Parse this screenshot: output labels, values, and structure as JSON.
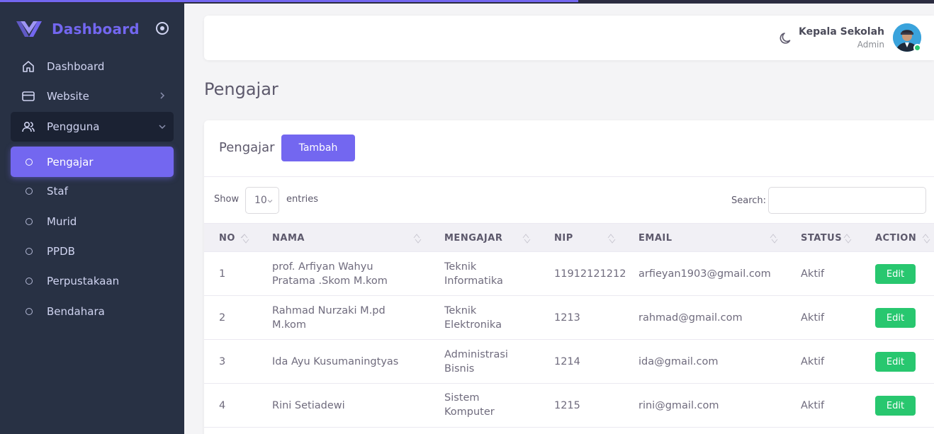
{
  "sidebar": {
    "brand": "Dashboard",
    "items": [
      {
        "label": "Dashboard",
        "icon": "home-icon"
      },
      {
        "label": "Website",
        "icon": "credit-card-icon"
      },
      {
        "label": "Pengguna",
        "icon": "users-icon"
      }
    ],
    "subitems": [
      {
        "label": "Pengajar"
      },
      {
        "label": "Staf"
      },
      {
        "label": "Murid"
      },
      {
        "label": "PPDB"
      },
      {
        "label": "Perpustakaan"
      },
      {
        "label": "Bendahara"
      }
    ]
  },
  "navbar": {
    "user_name": "Kepala Sekolah",
    "user_role": "Admin"
  },
  "page": {
    "title": "Pengajar"
  },
  "card": {
    "title": "Pengajar",
    "add_label": "Tambah",
    "show_label": "Show",
    "entries_value": "10",
    "entries_label": "entries",
    "search_label": "Search:",
    "search_value": ""
  },
  "table": {
    "columns": [
      "NO",
      "NAMA",
      "MENGAJAR",
      "NIP",
      "EMAIL",
      "STATUS",
      "ACTION"
    ],
    "rows": [
      {
        "no": "1",
        "nama1": "prof. Arfiyan Wahyu",
        "nama2": "Pratama .Skom M.kom",
        "mengajar1": "Teknik",
        "mengajar2": "Informatika",
        "nip": "11912121212",
        "email": "arfieyan1903@gmail.com",
        "status": "Aktif",
        "action": "Edit"
      },
      {
        "no": "2",
        "nama1": "Rahmad Nurzaki M.pd",
        "nama2": "M.kom",
        "mengajar1": "Teknik",
        "mengajar2": "Elektronika",
        "nip": "1213",
        "email": "rahmad@gmail.com",
        "status": "Aktif",
        "action": "Edit"
      },
      {
        "no": "3",
        "nama1": "Ida Ayu Kusumaningtyas",
        "nama2": "",
        "mengajar1": "Administrasi",
        "mengajar2": "Bisnis",
        "nip": "1214",
        "email": "ida@gmail.com",
        "status": "Aktif",
        "action": "Edit"
      },
      {
        "no": "4",
        "nama1": "Rini Setiadewi",
        "nama2": "",
        "mengajar1": "Sistem",
        "mengajar2": "Komputer",
        "nip": "1215",
        "email": "rini@gmail.com",
        "status": "Aktif",
        "action": "Edit"
      }
    ]
  },
  "colors": {
    "accent": "#7367f0",
    "sidebar_bg": "#283144",
    "success": "#28c76f"
  }
}
